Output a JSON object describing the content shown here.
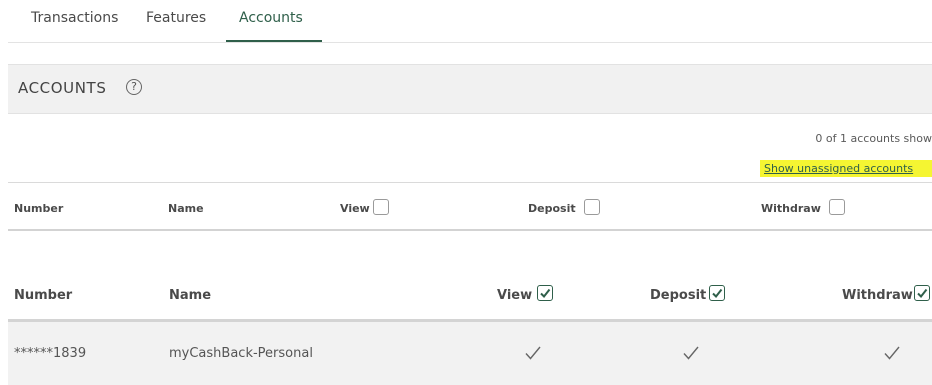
{
  "tabs": [
    {
      "label": "Transactions",
      "active": false
    },
    {
      "label": "Features",
      "active": false
    },
    {
      "label": "Accounts",
      "active": true
    }
  ],
  "section": {
    "title": "ACCOUNTS",
    "help_icon": "question-circle-icon",
    "help_glyph": "?"
  },
  "accounts_summary": {
    "count_text": "0 of 1 accounts show",
    "show_unassigned_link": "Show unassigned accounts"
  },
  "unassigned_table": {
    "columns": {
      "number": "Number",
      "name": "Name",
      "view": "View",
      "deposit": "Deposit",
      "withdraw": "Withdraw"
    },
    "select_all": {
      "view": false,
      "deposit": false,
      "withdraw": false
    }
  },
  "assigned_table": {
    "columns": {
      "number": "Number",
      "name": "Name",
      "view": "View",
      "deposit": "Deposit",
      "withdraw": "Withdraw"
    },
    "select_all": {
      "view": true,
      "deposit": true,
      "withdraw": true
    },
    "rows": [
      {
        "number": "******1839",
        "name": "myCashBack-Personal",
        "view": true,
        "deposit": true,
        "withdraw": true
      }
    ]
  },
  "colors": {
    "accent": "#2f5f4a",
    "highlight": "#f5f532",
    "header_bg": "#f1f1f1",
    "row_bg": "#f2f2f2"
  }
}
